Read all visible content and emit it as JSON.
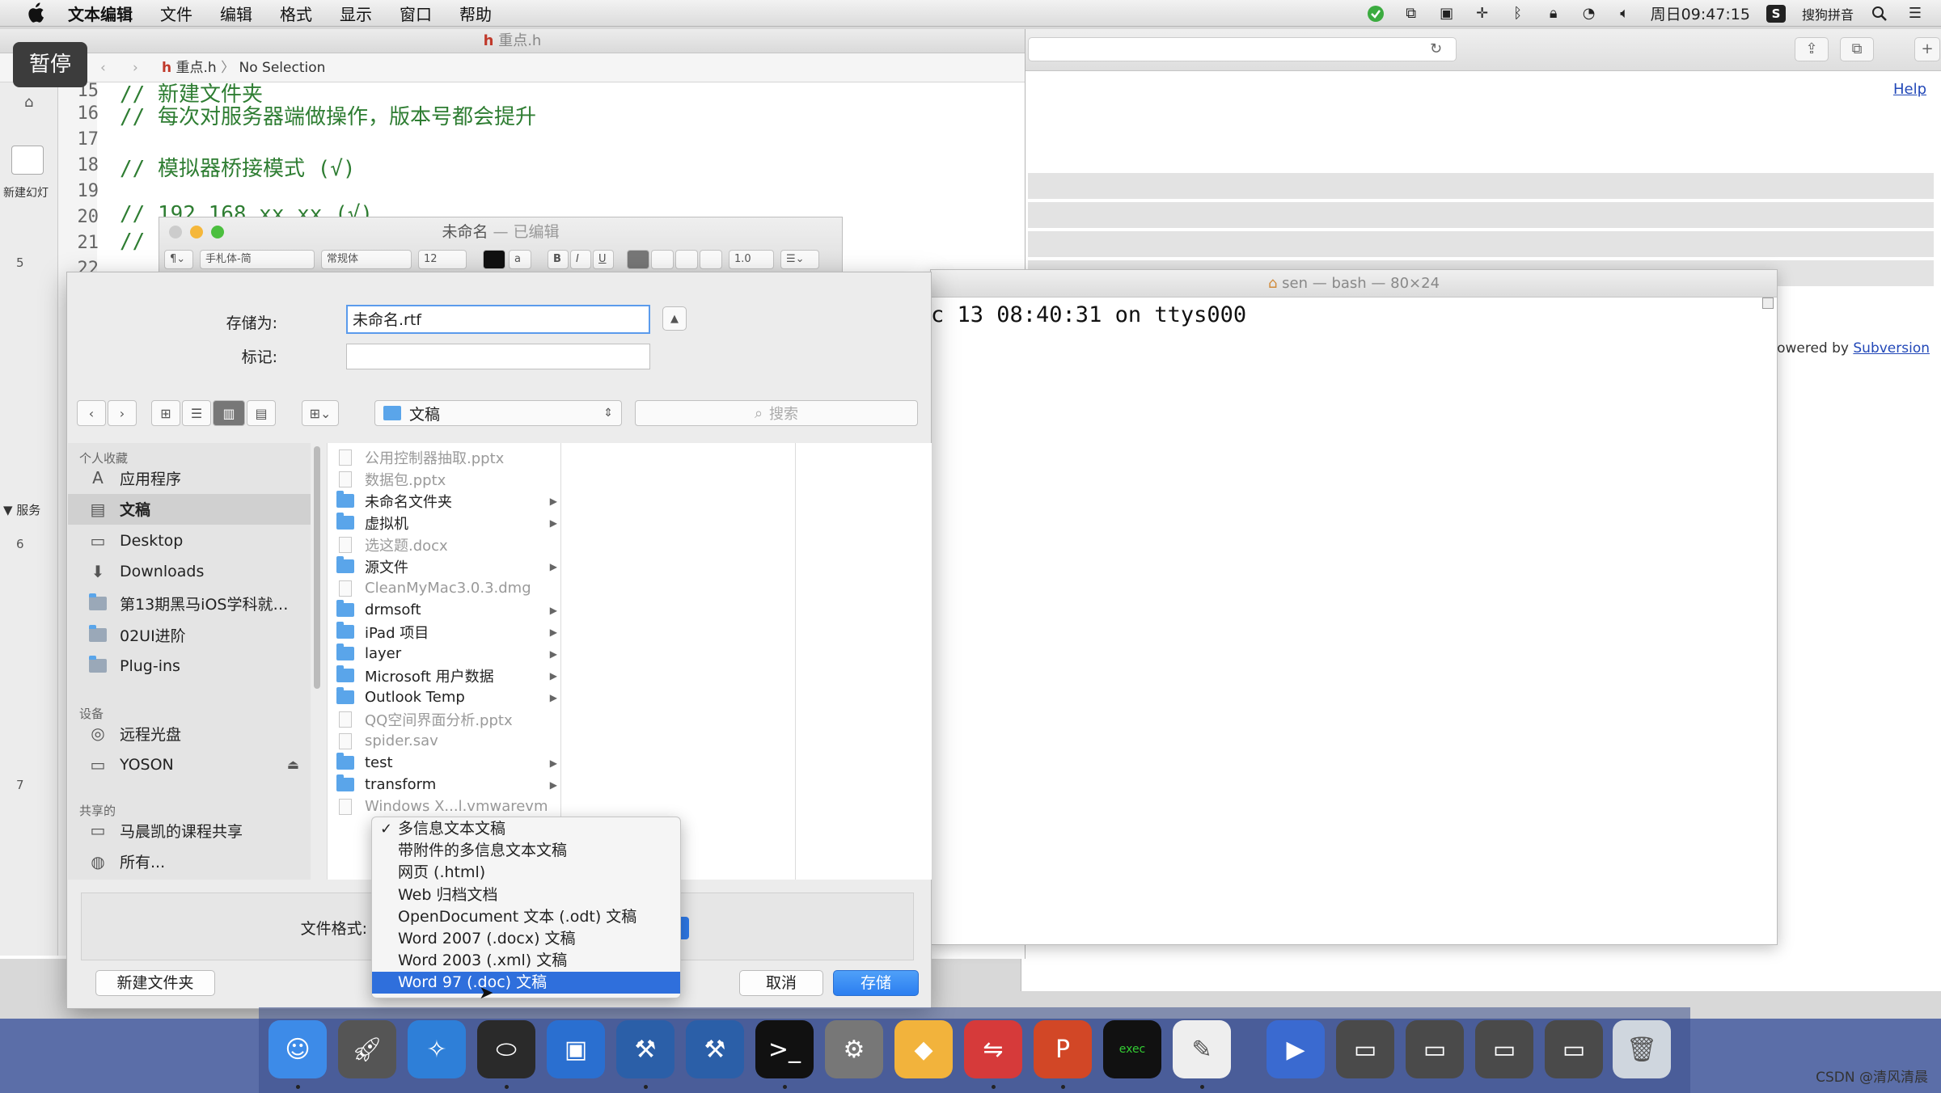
{
  "menubar": {
    "app_name": "文本编辑",
    "items": [
      "文件",
      "编辑",
      "格式",
      "显示",
      "窗口",
      "帮助"
    ],
    "clock": "周日09:47:15",
    "input_method": "搜狗拼音"
  },
  "overlay": {
    "pause_label": "暂停"
  },
  "xcode": {
    "title": "重点.h",
    "breadcrumb_file": "重点.h",
    "breadcrumb_selection": "No Selection",
    "lines": [
      {
        "num": "15",
        "text": "// 新建文件夹"
      },
      {
        "num": "16",
        "text": "// 每次对服务器端做操作，版本号都会提升"
      },
      {
        "num": "17",
        "text": ""
      },
      {
        "num": "18",
        "text": "// 模拟器桥接模式 (√)"
      },
      {
        "num": "19",
        "text": ""
      },
      {
        "num": "20",
        "text": "// 192.168.xx.xx (√)"
      },
      {
        "num": "21",
        "text": "//"
      },
      {
        "num": "22",
        "text": ""
      }
    ],
    "left_label": "新建幻灯",
    "left_nums": [
      "5",
      "6",
      "7"
    ],
    "left_section": "▼ 服务"
  },
  "browser": {
    "help_link": "Help",
    "powered_text": "powered by",
    "powered_link": "Subversion"
  },
  "terminal": {
    "title": "sen — bash — 80×24",
    "line1": "c 13 08:40:31 on ttys000"
  },
  "textedit": {
    "title": "未命名",
    "status": "已编辑",
    "font_family": "手札体-简",
    "font_style": "常规体",
    "font_size": "12",
    "line_spacing": "1.0"
  },
  "dialog": {
    "save_as_label": "存储为:",
    "save_as_value": "未命名.rtf",
    "tags_label": "标记:",
    "location": "文稿",
    "search_placeholder": "搜索",
    "sidebar": {
      "favorites_header": "个人收藏",
      "favorites": [
        {
          "label": "应用程序",
          "icon": "applications-icon"
        },
        {
          "label": "文稿",
          "icon": "documents-icon"
        },
        {
          "label": "Desktop",
          "icon": "desktop-icon"
        },
        {
          "label": "Downloads",
          "icon": "downloads-icon"
        },
        {
          "label": "第13期黑马iOS学科就…",
          "icon": "folder-icon"
        },
        {
          "label": "02UI进阶",
          "icon": "folder-icon"
        },
        {
          "label": "Plug-ins",
          "icon": "folder-icon"
        }
      ],
      "devices_header": "设备",
      "devices": [
        {
          "label": "远程光盘",
          "icon": "disc-icon"
        },
        {
          "label": "YOSON",
          "icon": "drive-icon"
        }
      ],
      "shared_header": "共享的",
      "shared": [
        {
          "label": "马晨凯的课程共享",
          "icon": "computer-icon"
        },
        {
          "label": "所有...",
          "icon": "network-icon"
        }
      ]
    },
    "files": [
      {
        "name": "公用控制器抽取.pptx",
        "kind": "doc",
        "grey": true,
        "arrow": false
      },
      {
        "name": "数据包.pptx",
        "kind": "doc",
        "grey": true,
        "arrow": false
      },
      {
        "name": "未命名文件夹",
        "kind": "folder",
        "grey": false,
        "arrow": true
      },
      {
        "name": "虚拟机",
        "kind": "folder",
        "grey": false,
        "arrow": true
      },
      {
        "name": "选这题.docx",
        "kind": "doc",
        "grey": true,
        "arrow": false
      },
      {
        "name": "源文件",
        "kind": "folder",
        "grey": false,
        "arrow": true
      },
      {
        "name": "CleanMyMac3.0.3.dmg",
        "kind": "doc",
        "grey": true,
        "arrow": false
      },
      {
        "name": "drmsoft",
        "kind": "folder",
        "grey": false,
        "arrow": true
      },
      {
        "name": "iPad 项目",
        "kind": "folder",
        "grey": false,
        "arrow": true
      },
      {
        "name": "layer",
        "kind": "folder",
        "grey": false,
        "arrow": true
      },
      {
        "name": "Microsoft 用户数据",
        "kind": "folder",
        "grey": false,
        "arrow": true
      },
      {
        "name": "Outlook Temp",
        "kind": "folder",
        "grey": false,
        "arrow": true
      },
      {
        "name": "QQ空间界面分析.pptx",
        "kind": "doc",
        "grey": true,
        "arrow": false
      },
      {
        "name": "spider.sav",
        "kind": "doc",
        "grey": true,
        "arrow": false
      },
      {
        "name": "test",
        "kind": "folder",
        "grey": false,
        "arrow": true
      },
      {
        "name": "transform",
        "kind": "folder",
        "grey": false,
        "arrow": true
      },
      {
        "name": "Windows X...l.vmwarevm",
        "kind": "doc",
        "grey": true,
        "arrow": false
      }
    ],
    "format_label": "文件格式:",
    "format_options": [
      "多信息文本文稿",
      "带附件的多信息文本文稿",
      "网页 (.html)",
      "Web 归档文档",
      "OpenDocument 文本 (.odt) 文稿",
      "Word 2007 (.docx) 文稿",
      "Word 2003 (.xml) 文稿",
      "Word 97 (.doc) 文稿"
    ],
    "checked_option_index": 0,
    "highlighted_option_index": 7,
    "new_folder_label": "新建文件夹",
    "cancel_label": "取消",
    "save_label": "存储"
  },
  "dock": {
    "apps": [
      "finder-icon",
      "launchpad-icon",
      "safari-icon",
      "mouse-icon",
      "keynote-icon",
      "xcode-icon",
      "instruments-icon",
      "terminal-icon",
      "system-preferences-icon",
      "sketch-icon",
      "parallels-icon",
      "powerpoint-icon",
      "exec-icon",
      "textedit-icon",
      "video-icon",
      "screen1-icon",
      "screen2-icon",
      "screen3-icon",
      "screen4-icon",
      "trash-icon"
    ]
  },
  "watermark": "CSDN @清风清晨"
}
